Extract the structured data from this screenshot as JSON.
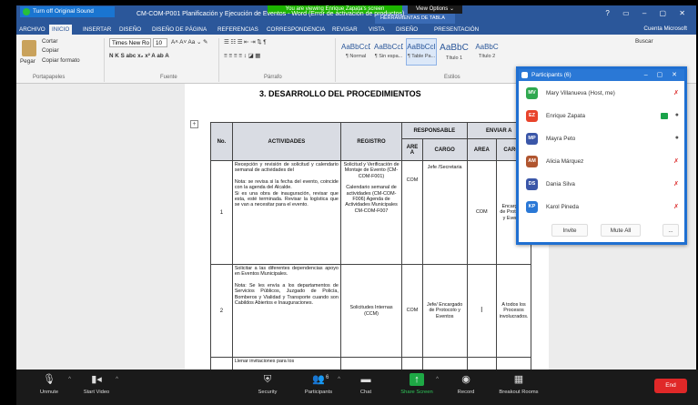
{
  "zoom_top": {
    "turn_off_sound": "Turn off Original Sound",
    "viewing_banner": "You are viewing Enrique Zapata's screen",
    "view_options": "View Options ⌄"
  },
  "word": {
    "title": "CM-COM-P001 Planificación y Ejecución de Eventos - Word (Error de activación de productos)",
    "context_tab": "HERRAMIENTAS DE TABLA",
    "window_controls": "? ▭ – ▢ ✕",
    "account": "Cuenta Microsoft",
    "tabs": [
      "ARCHIVO",
      "INICIO",
      "INSERTAR",
      "DISEÑO",
      "DISEÑO DE PÁGINA",
      "REFERENCIAS",
      "CORRESPONDENCIA",
      "REVISAR",
      "VISTA",
      "DISEÑO",
      "PRESENTACIÓN"
    ],
    "ribbon": {
      "paste": "Pegar",
      "cut": "Cortar",
      "copy": "Copiar",
      "copy_format": "Copiar formato",
      "font_name": "Times New Ro",
      "font_size": "10",
      "font_tools_1": "A˄ A˅  Aa ⌄  ✎",
      "font_tools_2": "N  K  S  abc  x₂  x²   A  ab  A",
      "para_tools_1": "☰ ☷ ☰  ⇤ ⇥  ⇅  ¶",
      "para_tools_2": "≡ ≡ ≡ ≡   ↕   ◪  ▦",
      "styles": [
        {
          "preview": "AaBbCcDc",
          "name": "¶ Normal"
        },
        {
          "preview": "AaBbCcDc",
          "name": "¶ Sin espa..."
        },
        {
          "preview": "AaBbCcI",
          "name": "¶ Table Pa..."
        },
        {
          "preview": "AaBbC",
          "name": "Título 1"
        },
        {
          "preview": "AaBbC",
          "name": "Título 2"
        }
      ],
      "find": "Buscar",
      "group_clipboard": "Portapapeles",
      "group_font": "Fuente",
      "group_para": "Párrafo",
      "group_styles": "Estilos"
    }
  },
  "doc": {
    "heading": "3. DESARROLLO DEL PROCEDIMIENTOS",
    "anchor": "+",
    "table": {
      "h_no": "No.",
      "h_activities": "ACTIVIDADES",
      "h_registro": "REGISTRO",
      "h_responsable": "RESPONSABLE",
      "h_enviar": "ENVIAR A",
      "h_area": "ARE A",
      "h_cargo": "CARGO",
      "h_area2": "AREA",
      "h_cargo2": "CARGO",
      "rows": [
        {
          "no": "1",
          "act_a": "Recepción y revisión de solicitud y calendario semanal de actividades del",
          "act_b": "Nota: se revisa si la fecha del evento, coincide con la agenda del Alcalde.",
          "act_c": "Si es una obra de inauguración, revisar que esta, esté terminada. Revisar la logística que se van a necesitar para el evento.",
          "reg_a": "Solicitud y Verificación de Montaje de Evento (CM-COM-F001)",
          "reg_b": "Calendario semanal de actividades (CM-COM-F006) Agenda de Actividades Municipales CM-COM-F007",
          "area": "COM",
          "cargo": "Jefe /Secretaria",
          "send_area": "COM",
          "send_cargo": "Encargado de Protocolo y Eventos"
        },
        {
          "no": "2",
          "act_a": "Solicitar a las diferentes dependencias apoyo en Eventos Municipales.",
          "act_b": "Nota: Se les envía a los departamentos de Servicios Públicos, Juzgado de Policía, Bomberos y Vialidad y Transporte cuando son Cabildos Abiertos e Inauguraciones.",
          "reg": "Solicitudes Internas (CCM)",
          "area": "COM",
          "cargo": "Jefe/ Encargado de Protocolo y Eventos",
          "send_area": "I",
          "send_cargo": "A todos los Procesos involucrados."
        },
        {
          "no": "",
          "act_a": "Llenar invitaciones para los",
          "reg": ""
        }
      ]
    }
  },
  "participants": {
    "title": "Participants (6)",
    "people": [
      {
        "initials": "MV",
        "name": "Mary Villanueva (Host, me)",
        "color": "#2fa84f"
      },
      {
        "initials": "EZ",
        "name": "Enrique Zapata",
        "color": "#e8442c"
      },
      {
        "initials": "MP",
        "name": "Mayra Peto",
        "color": "#3a56a8"
      },
      {
        "initials": "AM",
        "name": "Alicia Márquez",
        "color": "#b0552f"
      },
      {
        "initials": "DS",
        "name": "Dania Silva",
        "color": "#3a56a8"
      },
      {
        "initials": "KP",
        "name": "Karol Pineda",
        "color": "#2a78d6"
      }
    ],
    "invite": "Invite",
    "mute_all": "Mute All",
    "more": "..."
  },
  "toolbar": {
    "unmute": "Unmute",
    "start_video": "Start Video",
    "security": "Security",
    "participants": "Participants",
    "participant_count": "6",
    "chat": "Chat",
    "share": "Share Screen",
    "record": "Record",
    "breakout": "Breakout Rooms",
    "end": "End"
  }
}
